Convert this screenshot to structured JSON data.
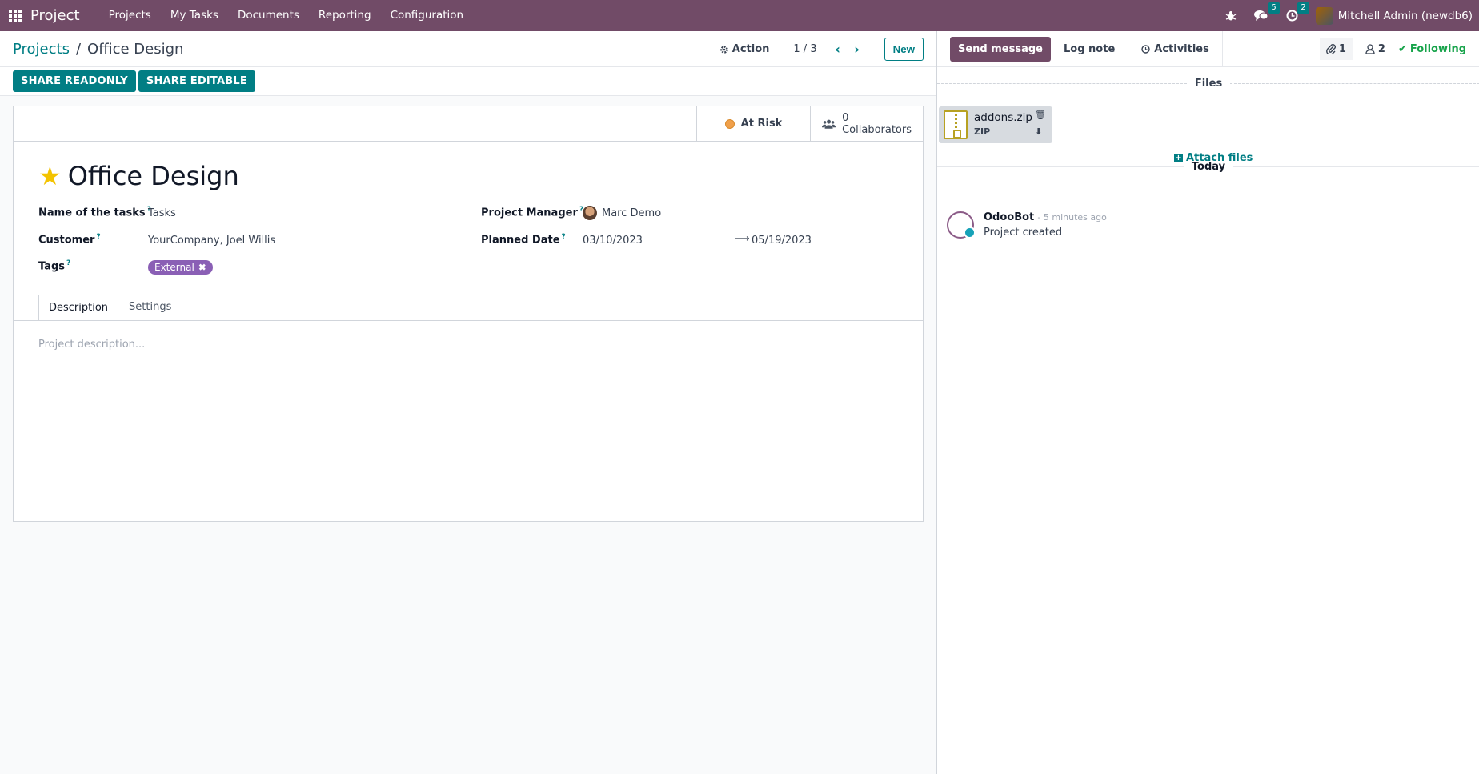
{
  "navbar": {
    "brand": "Project",
    "menu": [
      "Projects",
      "My Tasks",
      "Documents",
      "Reporting",
      "Configuration"
    ],
    "messages_badge": "5",
    "activities_badge": "2",
    "user": "Mitchell Admin (newdb6)"
  },
  "control": {
    "breadcrumb_parent": "Projects",
    "breadcrumb_separator": "/",
    "breadcrumb_current": "Office Design",
    "action_label": "Action",
    "pager": "1 / 3",
    "new_label": "New"
  },
  "statusbar": {
    "share_readonly": "SHARE READONLY",
    "share_editable": "SHARE EDITABLE"
  },
  "buttonbox": {
    "status_label": "At Risk",
    "collaborators_count": "0",
    "collaborators_label": "Collaborators"
  },
  "form": {
    "title": "Office Design",
    "fields": {
      "tasks_label": "Name of the tasks",
      "tasks_value": "Tasks",
      "customer_label": "Customer",
      "customer_value": "YourCompany, Joel Willis",
      "tags_label": "Tags",
      "tag_value": "External",
      "pm_label": "Project Manager",
      "pm_value": "Marc Demo",
      "planned_label": "Planned Date",
      "date_start": "03/10/2023",
      "date_end": "05/19/2023"
    },
    "tabs": [
      "Description",
      "Settings"
    ],
    "description_placeholder": "Project description..."
  },
  "chatter": {
    "send_message": "Send message",
    "log_note": "Log note",
    "activities": "Activities",
    "attachments_count": "1",
    "followers_count": "2",
    "following": "Following",
    "files_heading": "Files",
    "file_name": "addons.zip",
    "file_ext": "ZIP",
    "attach_files": "Attach files",
    "today_heading": "Today",
    "message": {
      "author": "OdooBot",
      "date": "- 5 minutes ago",
      "body": "Project created"
    }
  },
  "colors": {
    "brand": "#714b67",
    "accent": "#017e84",
    "tag": "#8a5fb5",
    "at_risk": "#f0a04b",
    "following": "#16a34a"
  }
}
